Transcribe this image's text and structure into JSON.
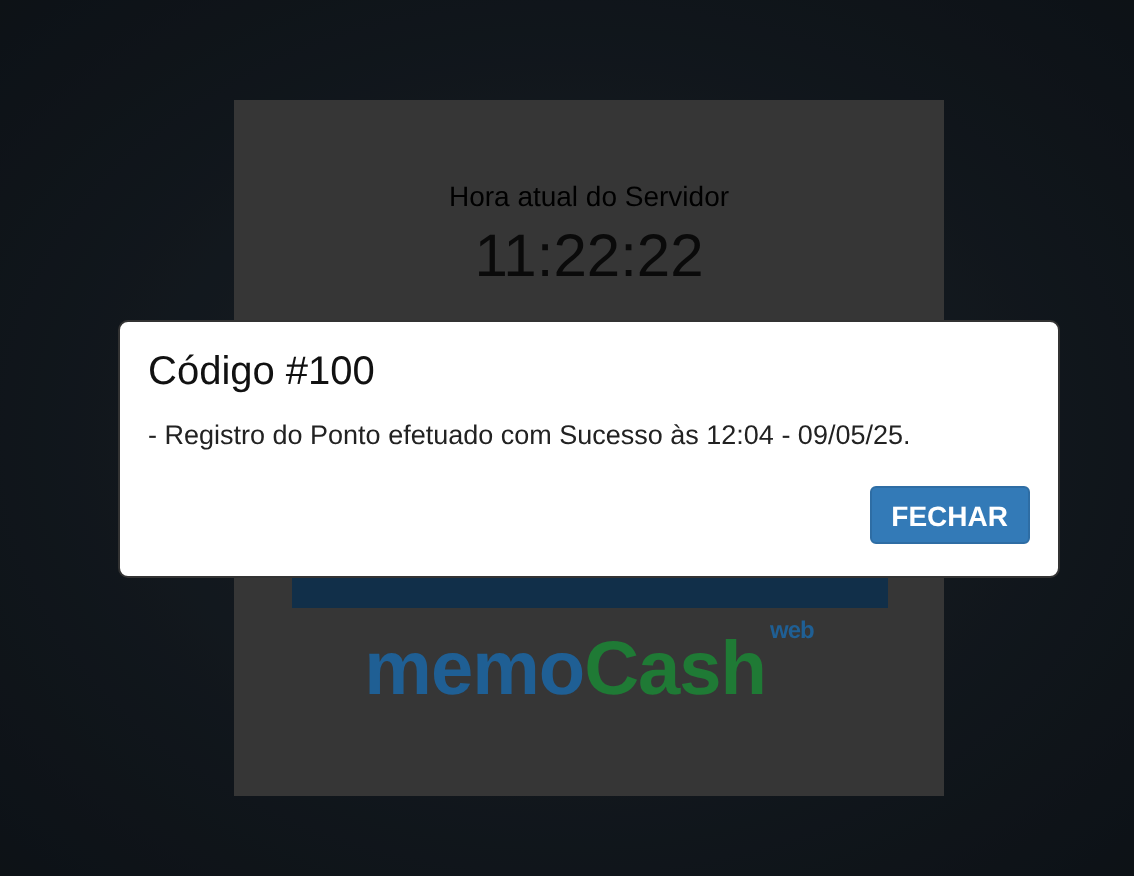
{
  "server_clock": {
    "label": "Hora atual do Servidor",
    "time": "11:22:22"
  },
  "logo": {
    "first": "memo",
    "second": "Cash",
    "superscript": "web"
  },
  "dialog": {
    "title": "Código #100",
    "message": "- Registro do Ponto efetuado com Sucesso às 12:04 - 09/05/25.",
    "buttons": [
      "FECHAR"
    ]
  }
}
